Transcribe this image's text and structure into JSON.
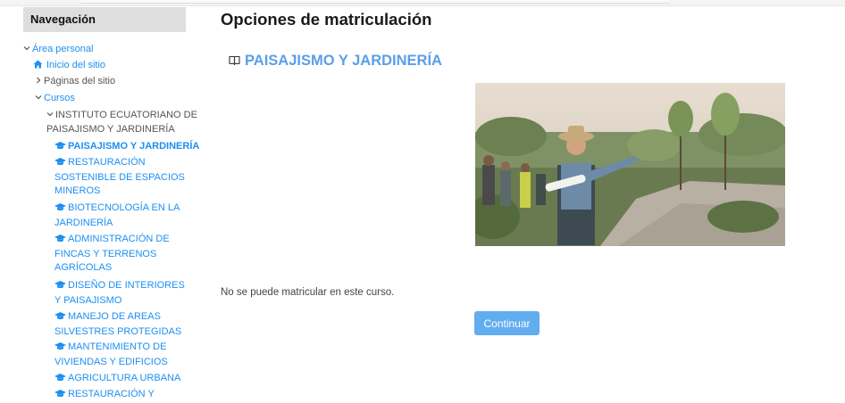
{
  "navigation": {
    "title": "Navegación",
    "area_personal": "Área personal",
    "inicio": "Inicio del sitio",
    "paginas": "Páginas del sitio",
    "cursos": "Cursos",
    "institute": "INSTITUTO ECUATORIANO DE PAISAJISMO Y JARDINERÍA",
    "courses": [
      "PAISAJISMO Y JARDINERÍA",
      "RESTAURACIÓN SOSTENIBLE DE ESPACIOS MINEROS",
      "BIOTECNOLOGÍA EN LA JARDINERÍA",
      "ADMINISTRACIÓN DE FINCAS Y TERRENOS AGRÍCOLAS",
      "DISEÑO DE INTERIORES Y PAISAJISMO",
      "MANEJO DE AREAS SILVESTRES PROTEGIDAS",
      "MANTENIMIENTO DE VIVIENDAS Y EDIFICIOS",
      "AGRICULTURA URBANA",
      "RESTAURACIÓN Y"
    ]
  },
  "main": {
    "title": "Opciones de matriculación",
    "course_name": "PAISAJISMO Y JARDINERÍA",
    "message": "No se puede matricular en este curso.",
    "continue_label": "Continuar"
  },
  "colors": {
    "link": "#1d8ff0",
    "heading": "#5a9fe8",
    "button": "#62adf0",
    "nav_header_bg": "#dedede"
  },
  "icons": {
    "course": "graduation-cap-icon",
    "home": "home-icon",
    "course_heading": "book-icon"
  }
}
